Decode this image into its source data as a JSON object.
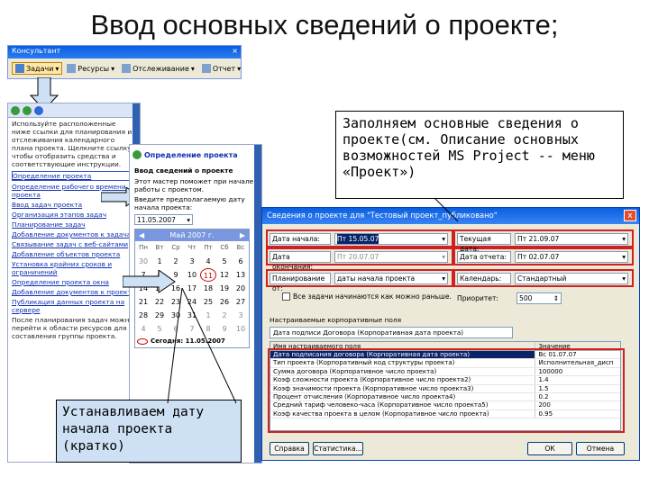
{
  "slide": {
    "title": "Ввод основных сведений о проекте;"
  },
  "toolbar": {
    "title": "Консультант",
    "close": "×",
    "buttons": [
      {
        "label": "Задачи",
        "active": true
      },
      {
        "label": "Ресурсы",
        "active": false
      },
      {
        "label": "Отслеживание",
        "active": false
      },
      {
        "label": "Отчет",
        "active": false
      }
    ]
  },
  "guide": {
    "intro": "Используйте расположенные ниже ссылки для планирования и отслеживания календарного плана проекта. Щелкните ссылку, чтобы отобразить средства и соответствующие инструкции.",
    "links": [
      "Определение проекта",
      "Определение рабочего времени проекта",
      "Ввод задач проекта",
      "Организация этапов задач",
      "Планирование задач",
      "Добавление документов к задачам",
      "Связывание задач с веб-сайтами",
      "Добавление объектов проекта",
      "Установка крайних сроков и ограничений",
      "Определение проекта окна",
      "Добавление документов к проекту",
      "Публикация данных проекта на сервере"
    ],
    "footer": "После планирования задач можно перейти к области ресурсов для составления группы проекта."
  },
  "mid": {
    "title": "Определение проекта",
    "heading": "Ввод сведений о проекте",
    "text1": "Этот мастер поможет при начале работы с проектом.",
    "text2": "Введите предполагаемую дату начала проекта:",
    "date_value": "11.05.2007",
    "calendar": {
      "month": "Май 2007 г.",
      "days": [
        "Пн",
        "Вт",
        "Ср",
        "Чт",
        "Пт",
        "Сб",
        "Вс"
      ],
      "rows": [
        [
          "30",
          "1",
          "2",
          "3",
          "4",
          "5",
          "6"
        ],
        [
          "7",
          "8",
          "9",
          "10",
          "11",
          "12",
          "13"
        ],
        [
          "14",
          "15",
          "16",
          "17",
          "18",
          "19",
          "20"
        ],
        [
          "21",
          "22",
          "23",
          "24",
          "25",
          "26",
          "27"
        ],
        [
          "28",
          "29",
          "30",
          "31",
          "1",
          "2",
          "3"
        ],
        [
          "4",
          "5",
          "6",
          "7",
          "8",
          "9",
          "10"
        ]
      ],
      "today": "Сегодня: 11.05.2007"
    }
  },
  "dialog": {
    "title": "Сведения о проекте для \"Тестовый проект_публиковано\"",
    "close": "x",
    "start_label": "Дата начала:",
    "start_value": "Пт 15.05.07",
    "finish_label": "Дата окончания:",
    "finish_value": "Пт 20.07.07",
    "schedule_label": "Планирование от:",
    "schedule_value": "даты начала проекта",
    "checkbox_label": "Все задачи начинаются как можно раньше.",
    "current_label": "Текущая дата:",
    "current_value": "Пт 21.09.07",
    "status_label": "Дата отчета:",
    "status_value": "Пт 02.07.07",
    "calendar_label": "Календарь:",
    "calendar_value": "Стандартный",
    "priority_label": "Приоритет:",
    "priority_value": "500",
    "custom_label": "Настраиваемые корпоративные поля",
    "custom_combo": "Дата подписи Договора (Корпоративная дата проекта)",
    "table_header": [
      "Имя настраиваемого поля",
      "Значение"
    ],
    "table_rows": [
      [
        "Дата подписания договора (Корпоративная дата проекта)",
        "Вс 01.07.07"
      ],
      [
        "Тип проекта (Корпоративный код структуры проекта)",
        "Исполнительная_дисп"
      ],
      [
        "Сумма договора (Корпоративное число проекта)",
        "100000"
      ],
      [
        "Коэф сложности проекта (Корпоративное число проекта2)",
        "1.4"
      ],
      [
        "Коэф значимости проекта (Корпоративное число проекта3)",
        "1.5"
      ],
      [
        "Процент отчисления (Корпоративное число проекта4)",
        "0.2"
      ],
      [
        "Средний тариф человеко-часа (Корпоративное число проекта5)",
        "200"
      ],
      [
        "Коэф качества проекта в целом (Корпоративное число проекта)",
        "0.95"
      ]
    ],
    "buttons": {
      "help": "Справка",
      "stats": "Статистика...",
      "ok": "ОК",
      "cancel": "Отмена"
    }
  },
  "callouts": {
    "top": "Заполняем основные сведения о проекте(см. Описание основных возможностей MS Project -- меню «Проект»)",
    "bottom": "Устанавливаем дату начала проекта (кратко)"
  },
  "colors": {
    "arrow_fill": "#cde0f4",
    "highlight_red": "#d02020",
    "xp_blue": "#0a5ee0"
  }
}
